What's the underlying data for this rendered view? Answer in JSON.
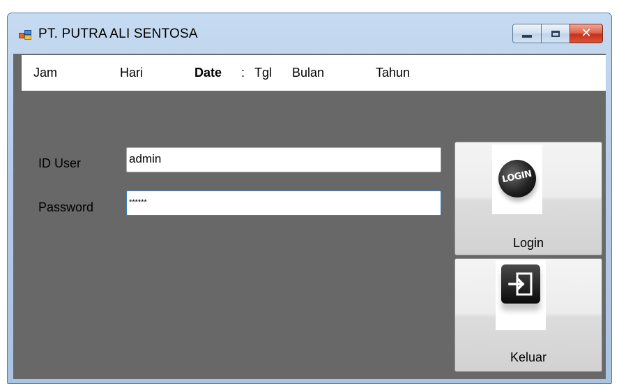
{
  "window": {
    "title": "PT. PUTRA ALI SENTOSA",
    "controls": {
      "minimize_icon": "minimize-icon",
      "maximize_icon": "maximize-icon",
      "close_icon": "close-icon",
      "close_glyph": "✕"
    }
  },
  "datebar": {
    "jam": "Jam",
    "hari": "Hari",
    "date_label": "Date",
    "separator": ":",
    "tgl": "Tgl",
    "bulan": "Bulan",
    "tahun": "Tahun"
  },
  "form": {
    "id_user_label": "ID User",
    "id_user_value": "admin",
    "password_label": "Password",
    "password_value": "******"
  },
  "buttons": {
    "login_label": "Login",
    "login_icon_text": "LOGIN",
    "exit_label": "Keluar"
  },
  "colors": {
    "client_background": "#686868",
    "datebar_background": "#ffffff",
    "titlebar": "#b6cde8",
    "close_button": "#c8321c"
  }
}
